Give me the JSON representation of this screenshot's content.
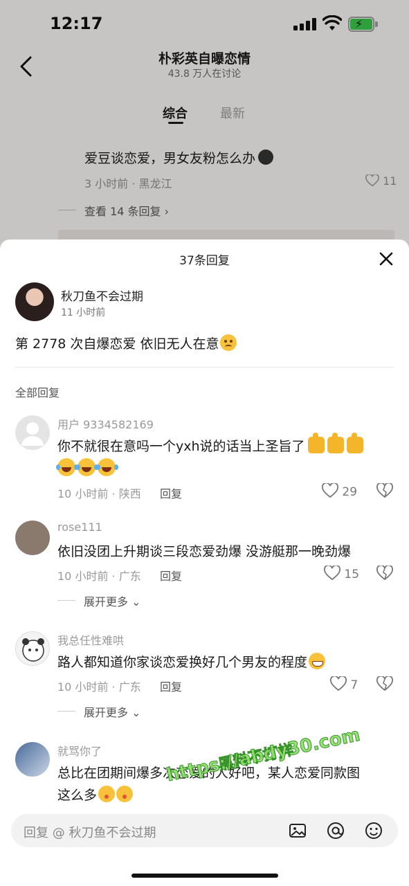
{
  "status_bar": {
    "time": "12:17"
  },
  "topic": {
    "title": "朴彩英自曝恋情",
    "subtitle": "43.8 万人在讨论",
    "tabs": [
      "综合",
      "最新"
    ]
  },
  "background_comment": {
    "text": "爱豆谈恋爱，男女友粉怎么办",
    "meta": "3 小时前 · 黑龙江",
    "likes": "11",
    "view_replies": "查看 14 条回复 ›"
  },
  "sheet": {
    "title": "37条回复",
    "original": {
      "name": "秋刀鱼不会过期",
      "time": "11 小时前",
      "text": "第 2778 次自爆恋爱 依旧无人在意"
    },
    "all_replies_label": "全部回复",
    "reply_label": "回复",
    "expand_label": "展开更多",
    "replies": [
      {
        "name": "用户 9334582169",
        "text": "你不就很在意吗一个yxh说的话当上圣旨了",
        "meta": "10 小时前 · 陕西",
        "likes": "29"
      },
      {
        "name": "rose111",
        "text": "依旧没团上升期谈三段恋爱劲爆 没游艇那一晚劲爆",
        "meta": "10 小时前 · 广东",
        "likes": "15"
      },
      {
        "name": "我总任性难哄",
        "text": "路人都知道你家谈恋爱换好几个男友的程度",
        "meta": "10 小时前 · 广东",
        "likes": "7"
      },
      {
        "name": "就骂你了",
        "text": "总比在团期间爆多次恋爱的人好吧，某人恋爱同款图",
        "text_line2": "这么多"
      }
    ],
    "watermark": "https://abdy30.com",
    "watermark_sub": "黑料不打烊"
  },
  "input_bar": {
    "placeholder": "回复 @ 秋刀鱼不会过期"
  },
  "icons": [
    "back-icon",
    "close-icon",
    "heart-icon",
    "dislike-icon",
    "image-icon",
    "at-icon",
    "emoji-icon"
  ]
}
